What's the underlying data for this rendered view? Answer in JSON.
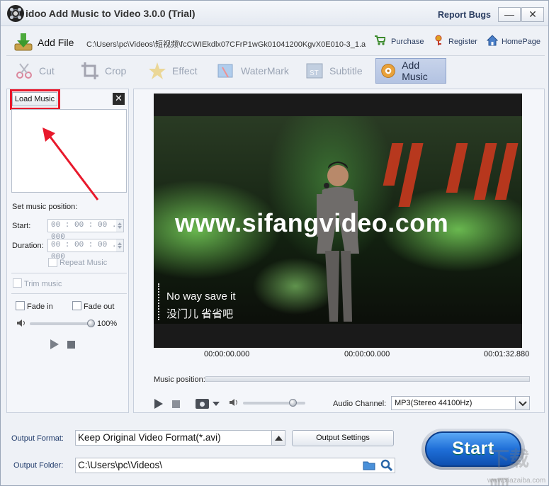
{
  "window": {
    "title": "idoo Add Music to Video 3.0.0 (Trial)",
    "report_bugs": "Report Bugs",
    "min_glyph": "—",
    "close_glyph": "✕"
  },
  "toolbar": {
    "add_file": "Add File",
    "file_path": "C:\\Users\\pc\\Videos\\短视频\\fcCWIEkdlx07CFrP1wGk01041200KgvX0E010-3_1.a",
    "purchase": "Purchase",
    "register": "Register",
    "homepage": "HomePage"
  },
  "tabs": [
    {
      "label": "Cut",
      "icon": "scissors-icon"
    },
    {
      "label": "Crop",
      "icon": "crop-icon"
    },
    {
      "label": "Effect",
      "icon": "effect-star-icon"
    },
    {
      "label": "WaterMark",
      "icon": "watermark-icon"
    },
    {
      "label": "Subtitle",
      "icon": "subtitle-icon"
    },
    {
      "label": "Add Music",
      "icon": "music-disc-icon",
      "active": true
    }
  ],
  "music_panel": {
    "load_music": "Load Music",
    "close_glyph": "✕",
    "set_position": "Set music position:",
    "start_label": "Start:",
    "start_value": "00 : 00 : 00 . 000",
    "duration_label": "Duration:",
    "duration_value": "00 : 00 : 00 . 000",
    "repeat_music": "Repeat Music",
    "trim_music": "Trim music",
    "fade_in": "Fade in",
    "fade_out": "Fade out",
    "volume": "100%",
    "volume_level": 1.0
  },
  "preview": {
    "watermark_text": "www.sifangvideo.com",
    "subtitle_en": "No way save it",
    "subtitle_cn": "没门儿 省省吧",
    "time_start": "00:00:00.000",
    "time_mid": "00:00:00.000",
    "time_end": "00:01:32.880",
    "music_position_label": "Music position:",
    "audio_channel_label": "Audio Channel:",
    "audio_channel_value": "MP3(Stereo 44100Hz)",
    "volume_level": 0.8
  },
  "output": {
    "format_label": "Output Format:",
    "format_value": "Keep Original Video Format(*.avi)",
    "settings_button": "Output Settings",
    "folder_label": "Output Folder:",
    "folder_value": "C:\\Users\\pc\\Videos\\",
    "start_button": "Start"
  },
  "corner_watermark": {
    "text": "下载吧",
    "url": "www.xiazaiba.com"
  },
  "colors": {
    "accent": "#1f6fd8",
    "highlight": "#e8192c",
    "active_tab": "#b3c3e2"
  }
}
